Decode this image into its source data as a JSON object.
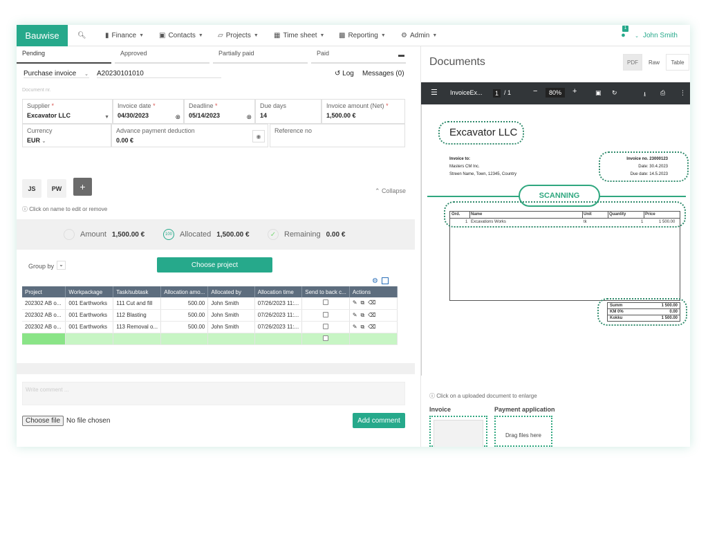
{
  "nav": {
    "brand": "Bauwise",
    "items": [
      {
        "label": "Finance",
        "icon": "wallet-icon"
      },
      {
        "label": "Contacts",
        "icon": "contacts-icon"
      },
      {
        "label": "Projects",
        "icon": "folder-icon"
      },
      {
        "label": "Time sheet",
        "icon": "calendar-icon"
      },
      {
        "label": "Reporting",
        "icon": "chart-icon"
      },
      {
        "label": "Admin",
        "icon": "gear-icon"
      }
    ],
    "notification_count": "1",
    "user": "John Smith"
  },
  "status_tabs": [
    "Pending",
    "Approved",
    "Partially paid",
    "Paid"
  ],
  "invoice": {
    "type": "Purchase invoice",
    "number": "A20230101010",
    "log_label": "Log",
    "messages_label": "Messages (0)",
    "document_nr_placeholder": "Document nr.",
    "supplier_label": "Supplier",
    "supplier": "Excavator LLC",
    "invoice_date_label": "Invoice date",
    "invoice_date": "04/30/2023",
    "deadline_label": "Deadline",
    "deadline": "05/14/2023",
    "due_days_label": "Due days",
    "due_days": "14",
    "amount_label": "Invoice amount (Net)",
    "amount": "1,500.00 €",
    "currency_label": "Currency",
    "currency": "EUR",
    "advance_label": "Advance payment deduction",
    "advance": "0.00 €",
    "reference_label": "Reference no"
  },
  "approvers": {
    "initials": [
      "JS",
      "PW"
    ],
    "add_label": "+",
    "collapse_label": "Collapse",
    "hint": "Click on name to edit or remove"
  },
  "summary": {
    "amount_label": "Amount",
    "amount": "1,500.00 €",
    "allocated_label": "Allocated",
    "allocated": "1,500.00 €",
    "allocated_badge": "100",
    "remaining_label": "Remaining",
    "remaining": "0.00 €"
  },
  "allocation": {
    "group_by_label": "Group by",
    "choose_project_label": "Choose project",
    "columns": [
      "Project",
      "Workpackage",
      "Task/subtask",
      "Allocation amo...",
      "Allocated by",
      "Allocation time",
      "Send to back c...",
      "Actions"
    ],
    "rows": [
      {
        "project": "202302 AB o...",
        "workpackage": "001 Earthworks",
        "task": "111 Cut and fill",
        "amount": "500.00",
        "by": "John Smith",
        "time": "07/26/2023 11:..."
      },
      {
        "project": "202302 AB o...",
        "workpackage": "001 Earthworks",
        "task": "112 Blasting",
        "amount": "500.00",
        "by": "John Smith",
        "time": "07/26/2023 11:..."
      },
      {
        "project": "202302 AB o...",
        "workpackage": "001 Earthworks",
        "task": "113 Removal o...",
        "amount": "500.00",
        "by": "John Smith",
        "time": "07/26/2023 11:..."
      }
    ]
  },
  "comment": {
    "placeholder": "Write comment ...",
    "choose_file_label": "Choose file",
    "no_file_label": "No file chosen",
    "add_label": "Add comment"
  },
  "documents": {
    "title": "Documents",
    "view_tabs": [
      "PDF",
      "Raw",
      "Table"
    ],
    "active_view": "PDF",
    "pdf": {
      "file_name": "InvoiceEx...",
      "page": "1",
      "page_total": "/ 1",
      "zoom": "80%"
    },
    "invoice_doc": {
      "company": "Excavator LLC",
      "invoice_to_label": "Invoice to:",
      "customer": "Masters CM Inc.",
      "address": "Streen Name, Town, 12345, Country",
      "invoice_no": "Invoice no. 23000123",
      "date": "Date: 30.4.2023",
      "due_date": "Due date: 14.5.2023",
      "scanning_label": "SCANNING",
      "table_head": [
        "Ord.",
        "Name",
        "Unit",
        "Quantity",
        "Price"
      ],
      "table_row": [
        "1",
        "Excavations Works",
        "tk",
        "1",
        "1 500.00"
      ],
      "totals": [
        {
          "label": "Summ",
          "value": "1 500.00"
        },
        {
          "label": "KM 0%",
          "value": "0.00"
        },
        {
          "label": "Kokku",
          "value": "1 500.00"
        }
      ]
    },
    "upload_hint": "Click on a uploaded document to enlarge",
    "invoice_slot_label": "Invoice",
    "payment_slot_label": "Payment application",
    "drag_label": "Drag files here"
  },
  "colors": {
    "accent": "#26a98b",
    "table_header": "#5d6d7e",
    "new_row": "#c7f5c4"
  }
}
